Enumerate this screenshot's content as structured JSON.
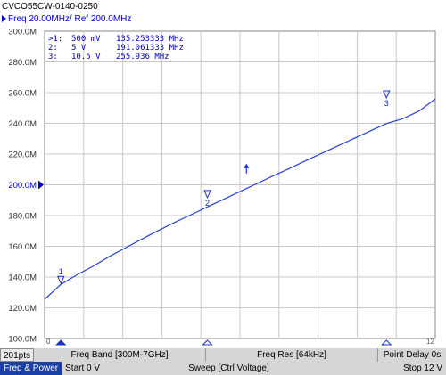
{
  "window": {
    "title": "CVCO55CW-0140-0250"
  },
  "channel": {
    "scale_label": "Freq 20.00MHz/ Ref 200.0MHz"
  },
  "markers": [
    {
      "id": ">1:",
      "x_label": "500 mV",
      "value": "135.253333 MHz",
      "symbol": "1"
    },
    {
      "id": "2:",
      "x_label": "5 V",
      "value": "191.061333 MHz",
      "symbol": "2"
    },
    {
      "id": "3:",
      "x_label": "10.5 V",
      "value": "255.936 MHz",
      "symbol": "3"
    }
  ],
  "status": {
    "points": "201pts",
    "freq_band": "Freq Band [300M-7GHz]",
    "freq_res": "Freq Res [64kHz]",
    "point_delay": "Point Delay 0s"
  },
  "bottom": {
    "tab": "Freq & Power",
    "start": "Start 0 V",
    "sweep": "Sweep [Ctrl Voltage]",
    "stop": "Stop 12 V"
  },
  "chart_data": {
    "type": "line",
    "x": [
      0,
      0.5,
      1,
      1.5,
      2,
      2.5,
      3,
      3.5,
      4,
      4.5,
      5,
      5.5,
      6,
      6.5,
      7,
      7.5,
      8,
      8.5,
      9,
      9.5,
      10,
      10.5,
      11,
      11.5,
      12
    ],
    "values": [
      125.5,
      135.25,
      141.5,
      147.2,
      153.5,
      159.2,
      164.8,
      170.3,
      175.6,
      180.6,
      185.6,
      190.6,
      195.6,
      200.6,
      205.6,
      210.5,
      215.5,
      220.4,
      225.3,
      230.2,
      235.0,
      239.9,
      243.0,
      248.0,
      255.9
    ],
    "ylim": [
      100,
      300
    ],
    "xlim": [
      0,
      12
    ],
    "xlabel": "",
    "ylabel": "",
    "y_ticks": [
      "300.0M",
      "280.0M",
      "260.0M",
      "240.0M",
      "220.0M",
      "200.0M",
      "180.0M",
      "160.0M",
      "140.0M",
      "120.0M",
      "100.0M"
    ],
    "x_tick_start": "0",
    "x_tick_end": "12",
    "reference_value": 200,
    "markers": [
      {
        "label": "1",
        "x": 0.5,
        "y": 135.253333
      },
      {
        "label": "2",
        "x": 5,
        "y": 191.061333
      },
      {
        "label": "3",
        "x": 10.5,
        "y": 255.936
      }
    ],
    "active_marker": {
      "x": 6.2,
      "y": 212
    },
    "colors": {
      "line": "#2a3fcf",
      "grid": "#c8c8c8",
      "marker": "#1a30c8"
    }
  }
}
